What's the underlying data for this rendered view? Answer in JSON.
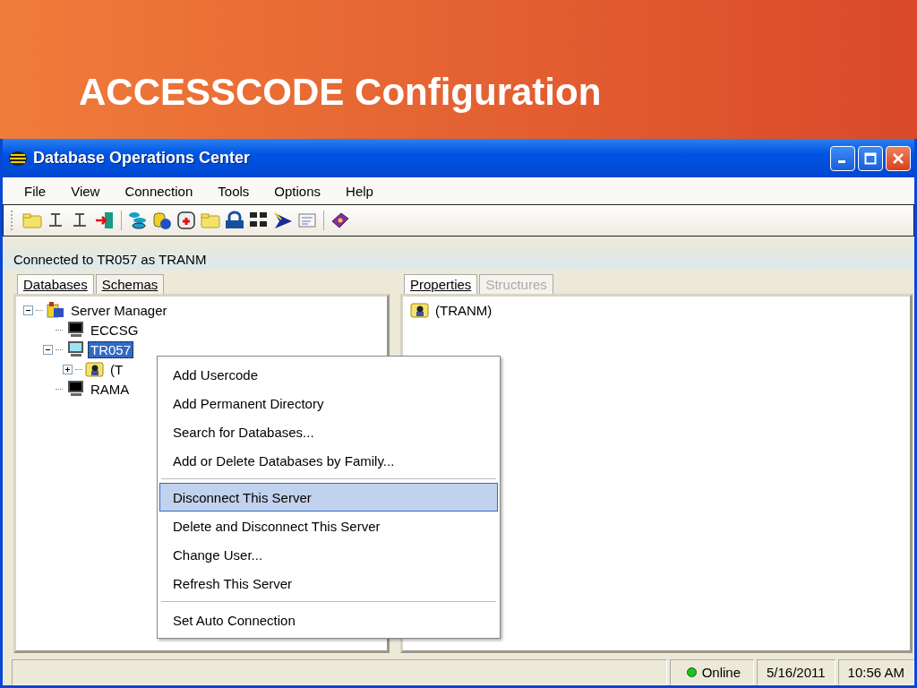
{
  "slide_title": "ACCESSCODE Configuration",
  "window": {
    "title": "Database Operations Center"
  },
  "menu_bar": [
    "File",
    "View",
    "Connection",
    "Tools",
    "Options",
    "Help"
  ],
  "connection_status": "Connected to TR057 as TRANM",
  "left_tabs": [
    {
      "label": "Databases",
      "selected": true,
      "disabled": false
    },
    {
      "label": "Schemas",
      "selected": false,
      "disabled": false
    }
  ],
  "tree": [
    {
      "label": "Server Manager",
      "kind": "server-manager",
      "expanded": true,
      "selected": false,
      "children": [
        {
          "label": "ECCSG",
          "kind": "computer-off",
          "selected": false
        },
        {
          "label": "TR057",
          "kind": "computer-on",
          "expanded": true,
          "selected": true,
          "children": [
            {
              "label": "(T",
              "kind": "user-folder",
              "expanded": false,
              "selected": false
            }
          ]
        },
        {
          "label": "RAMA",
          "kind": "computer-off",
          "selected": false
        }
      ]
    }
  ],
  "right_tabs": [
    {
      "label": "Properties",
      "selected": true,
      "disabled": false
    },
    {
      "label": "Structures",
      "selected": false,
      "disabled": true
    }
  ],
  "properties": [
    {
      "label": "(TRANM)",
      "kind": "user-folder"
    }
  ],
  "context_menu": [
    {
      "kind": "item",
      "label": "Add Usercode",
      "selected": false
    },
    {
      "kind": "item",
      "label": "Add Permanent Directory",
      "selected": false
    },
    {
      "kind": "item",
      "label": "Search for Databases...",
      "selected": false
    },
    {
      "kind": "item",
      "label": "Add or Delete Databases by Family...",
      "selected": false
    },
    {
      "kind": "separator"
    },
    {
      "kind": "item",
      "label": "Disconnect This Server",
      "selected": true
    },
    {
      "kind": "item",
      "label": "Delete and Disconnect This Server",
      "selected": false
    },
    {
      "kind": "item",
      "label": "Change User...",
      "selected": false
    },
    {
      "kind": "item",
      "label": "Refresh This Server",
      "selected": false
    },
    {
      "kind": "separator"
    },
    {
      "kind": "item",
      "label": "Set Auto Connection",
      "selected": false
    }
  ],
  "status_bar": {
    "connection": "Online",
    "date": "5/16/2011",
    "time": "10:56 AM"
  }
}
